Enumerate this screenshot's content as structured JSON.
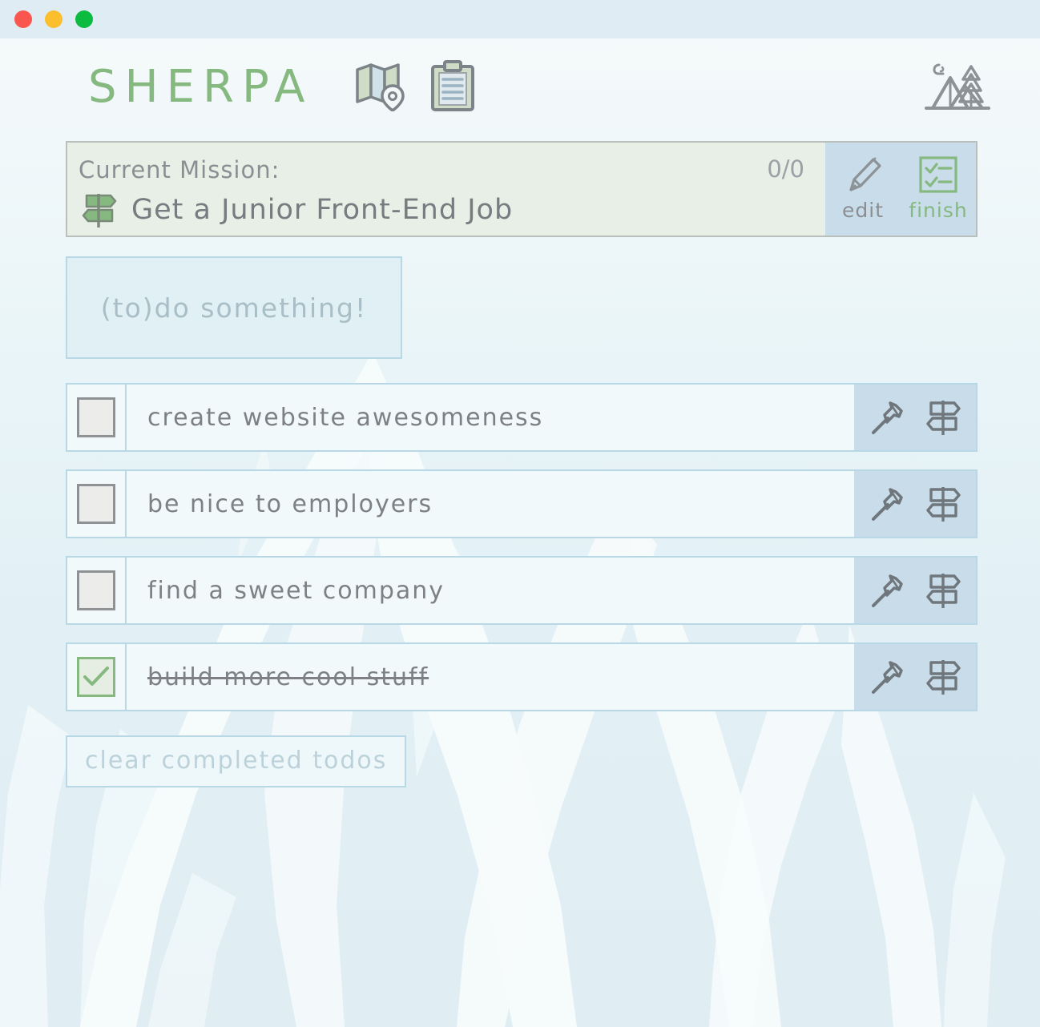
{
  "window": {
    "traffic_lights": [
      {
        "name": "close",
        "color": "#f9564f"
      },
      {
        "name": "minimize",
        "color": "#fbbe2d"
      },
      {
        "name": "zoom",
        "color": "#0cbb3f"
      }
    ]
  },
  "header": {
    "logo": "SHERPA",
    "icons": [
      {
        "name": "map-icon",
        "label": "map"
      },
      {
        "name": "clipboard-icon",
        "label": "clipboard"
      },
      {
        "name": "camp-icon",
        "label": "camp"
      }
    ]
  },
  "mission": {
    "label": "Current Mission:",
    "title": "Get a Junior Front-End Job",
    "count": "0/0",
    "signpost_icon": "signpost-icon",
    "edit_label": "edit",
    "finish_label": "finish",
    "edit_icon": "pencil-icon",
    "finish_icon": "checklist-icon"
  },
  "new_todo": {
    "placeholder": "(to)do something!",
    "value": ""
  },
  "todos": [
    {
      "text": "create website awesomeness",
      "done": false
    },
    {
      "text": "be nice to employers",
      "done": false
    },
    {
      "text": "find a sweet company",
      "done": false
    },
    {
      "text": "build more cool stuff",
      "done": true
    }
  ],
  "row_actions": [
    {
      "name": "axe-icon",
      "label": "chop"
    },
    {
      "name": "signpost-icon",
      "label": "signpost"
    }
  ],
  "clear_button": {
    "label": "clear completed todos"
  },
  "colors": {
    "brand_green": "#85b97f",
    "accent_blue": "#b9d8e6",
    "action_panel": "#c8dce9",
    "mission_bg": "#e8efe6",
    "input_bg": "#e0f0f4",
    "text_gray": "#7d8185"
  }
}
